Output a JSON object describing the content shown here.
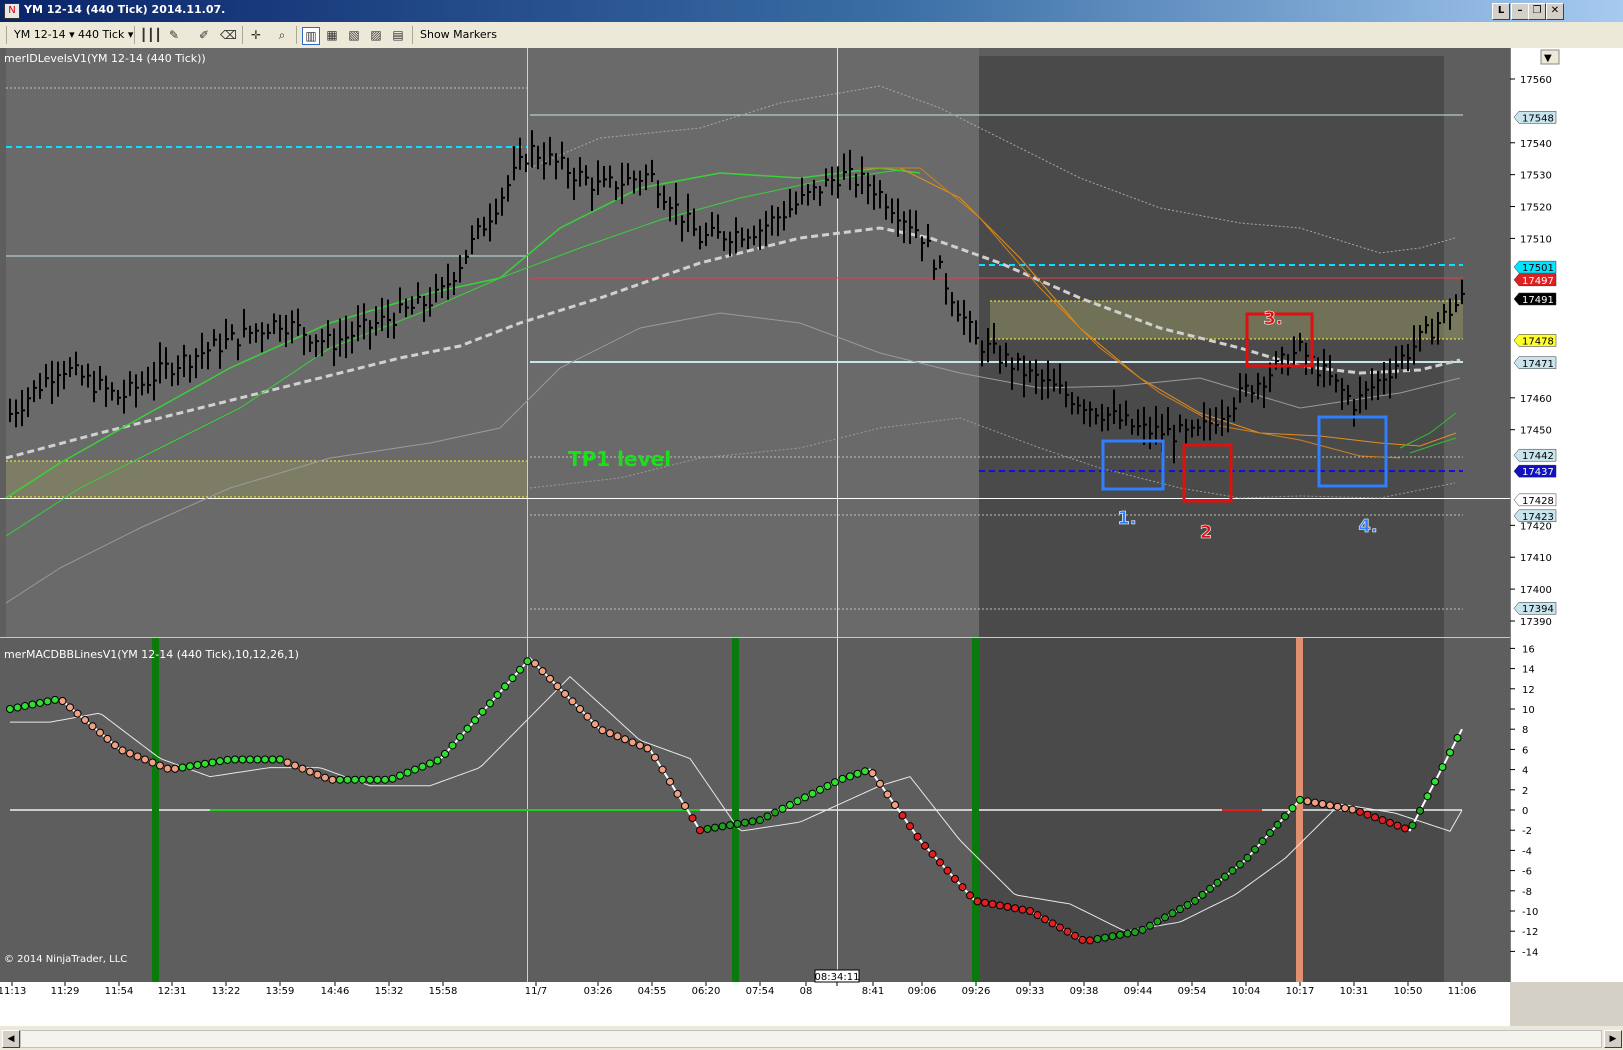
{
  "window": {
    "title": "YM 12-14 (440 Tick)  2014.11.07.",
    "buttons": [
      "L",
      "–",
      "❐",
      "✕"
    ]
  },
  "toolbar": {
    "instrument": "YM 12-14",
    "interval": "440 Tick",
    "show_markers": "Show Markers"
  },
  "price_panel": {
    "indicator_label": "merIDLevelsV1(YM 12-14 (440 Tick))",
    "annotation_tp1": "TP1 level",
    "y_ticks": [
      17560,
      17540,
      17530,
      17520,
      17510,
      17460,
      17450,
      17420,
      17410,
      17400,
      17390
    ],
    "price_markers": [
      {
        "value": 17548,
        "text": "17548",
        "bg": "#c8e4ec",
        "fg": "#000000"
      },
      {
        "value": 17501,
        "text": "17501",
        "bg": "#00e5ff",
        "fg": "#000000"
      },
      {
        "value": 17497,
        "text": "17497",
        "bg": "#e02020",
        "fg": "#ffffff"
      },
      {
        "value": 17491,
        "text": "17491",
        "bg": "#000000",
        "fg": "#ffffff"
      },
      {
        "value": 17478,
        "text": "17478",
        "bg": "#ffff30",
        "fg": "#000000"
      },
      {
        "value": 17471,
        "text": "17471",
        "bg": "#c8e4ec",
        "fg": "#000000"
      },
      {
        "value": 17442,
        "text": "17442",
        "bg": "#c8e4ec",
        "fg": "#000000"
      },
      {
        "value": 17437,
        "text": "17437",
        "bg": "#1010c0",
        "fg": "#ffffff"
      },
      {
        "value": 17428,
        "text": "17428",
        "bg": "#ffffff",
        "fg": "#000000"
      },
      {
        "value": 17423,
        "text": "17423",
        "bg": "#c8e4ec",
        "fg": "#000000"
      },
      {
        "value": 17394,
        "text": "17394",
        "bg": "#c8e4ec",
        "fg": "#000000"
      }
    ],
    "boxes": [
      {
        "label": "1.",
        "color": "#2f7fff"
      },
      {
        "label": "2",
        "color": "#e01010"
      },
      {
        "label": "3.",
        "color": "#e01010"
      },
      {
        "label": "4.",
        "color": "#2f7fff"
      }
    ]
  },
  "macd_panel": {
    "indicator_label": "merMACDBBLinesV1(YM 12-14 (440 Tick),10,12,26,1)",
    "y_ticks": [
      16,
      14,
      12,
      10,
      8,
      6,
      4,
      2,
      0,
      -2,
      -4,
      -6,
      -8,
      -10,
      -12,
      -14
    ],
    "copyright": "© 2014 NinjaTrader, LLC"
  },
  "x_axis": {
    "labels": [
      "11:13",
      "11:29",
      "11:54",
      "12:31",
      "13:22",
      "13:59",
      "14:46",
      "15:32",
      "15:58",
      "11/7",
      "03:26",
      "04:55",
      "06:20",
      "07:54",
      "08",
      "08:34:11",
      "8:41",
      "09:06",
      "09:26",
      "09:33",
      "09:38",
      "09:44",
      "09:54",
      "10:04",
      "10:17",
      "10:31",
      "10:50",
      "11:06"
    ]
  },
  "chart_data": {
    "type": "line",
    "title": "",
    "price_range": [
      17385,
      17565
    ],
    "macd_range": [
      -15,
      17
    ],
    "x": [
      "11:13",
      "11:29",
      "11:54",
      "12:31",
      "13:22",
      "13:59",
      "14:46",
      "15:32",
      "15:58",
      "11/7",
      "03:26",
      "04:55",
      "06:20",
      "07:54",
      "08:34:11",
      "8:41",
      "09:06",
      "09:26",
      "09:33",
      "09:38",
      "09:44",
      "09:54",
      "10:04",
      "10:17",
      "10:31",
      "10:50",
      "11:06"
    ],
    "series": [
      {
        "name": "",
        "values": [
          17455,
          17470,
          17460,
          17470,
          17478,
          17484,
          17477,
          17485,
          17492,
          17538,
          17526,
          17530,
          17510,
          17513,
          17530,
          17527,
          17512,
          17478,
          17467,
          17458,
          17450,
          17448,
          17462,
          17475,
          17458,
          17475,
          17491
        ]
      }
    ],
    "macd": [
      10,
      11,
      6,
      4,
      5,
      5,
      3,
      3,
      5,
      15,
      8,
      6,
      -2,
      -1,
      3,
      4,
      -3,
      -9,
      -10,
      -13,
      -12,
      -9,
      -5,
      1,
      0,
      -2,
      8
    ]
  }
}
